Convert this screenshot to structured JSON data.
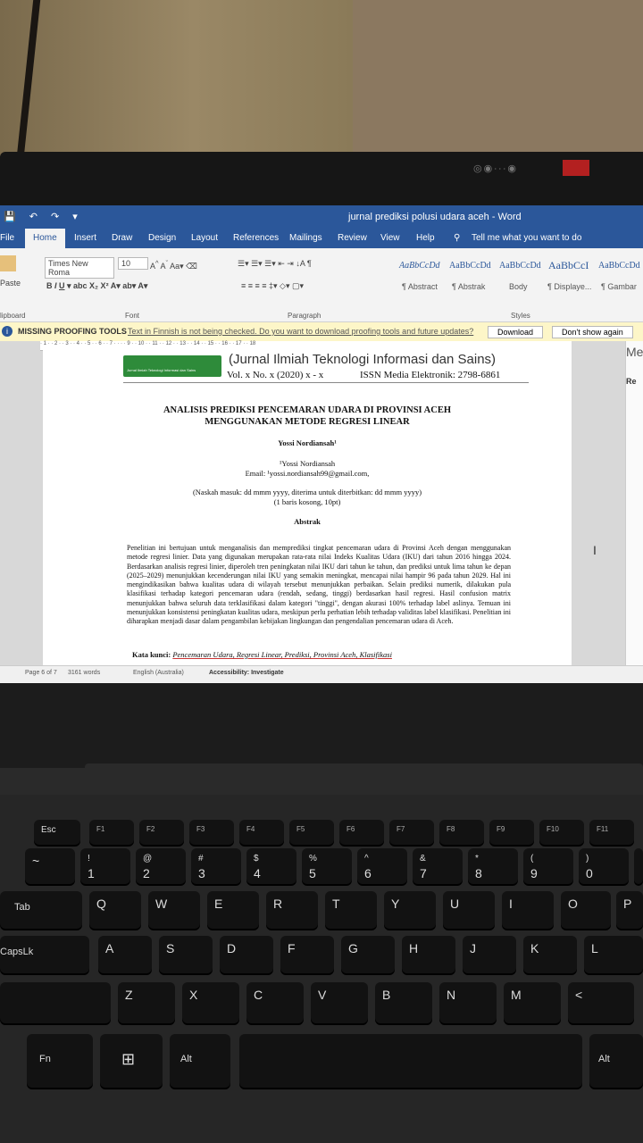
{
  "word": {
    "quick_access": "💾 ↶ ↷ ▾",
    "window_title": "jurnal prediksi polusi udara aceh  -  Word",
    "tabs": [
      "File",
      "Home",
      "Insert",
      "Draw",
      "Design",
      "Layout",
      "References",
      "Mailings",
      "Review",
      "View",
      "Help"
    ],
    "tell_me": "Tell me what you want to do",
    "font_name": "Times New Roma",
    "font_size": "10",
    "paste_label": "Paste",
    "group_clipboard": "lipboard",
    "group_font": "Font",
    "group_paragraph": "Paragraph",
    "group_styles": "Styles",
    "styles": [
      {
        "sample": "AaBbCcDd",
        "name": "¶ Abstract"
      },
      {
        "sample": "AaBbCcDd",
        "name": "¶ Abstrak"
      },
      {
        "sample": "AaBbCcDd",
        "name": "Body"
      },
      {
        "sample": "AaBbCcI",
        "name": "¶ Displaye..."
      },
      {
        "sample": "AaBbCcDd",
        "name": "¶ Gambar"
      }
    ],
    "proofing_label": "MISSING PROOFING TOOLS",
    "proofing_text": "Text in Finnish is not being checked. Do you want to download proofing tools and future updates?",
    "download_button": "Download",
    "dont_show_button": "Don't show again",
    "ruler_marks": "· 1 · · 2 · · 3 · · 4 · · 5 · · 6 · · 7 · · · · 9 · · 10 · · 11 · · 12 · · 13 · · 14 · · 15 · · 16 · · 17 · · 18",
    "side_pane": {
      "top": "Me",
      "sub": "Re"
    },
    "status": {
      "page": "Page 6 of 7",
      "words": "3161 words",
      "language": "English (Australia)",
      "accessibility": "Accessibility: Investigate"
    }
  },
  "document": {
    "journal_name": "(Jurnal Ilmiah Teknologi Informasi dan Sains)",
    "logo_tagline": "Jurnal Ilmiah Teknologi Informasi dan Sains",
    "volume": "Vol. x No. x (2020) x - x",
    "issn": "ISSN Media Elektronik: 2798-6861",
    "title_line1": "ANALISIS PREDIKSI PENCEMARAN UDARA DI PROVINSI ACEH",
    "title_line2": "MENGGUNAKAN METODE REGRESI LINEAR",
    "author": "Yossi Nordiansah¹",
    "affiliation": "¹Yossi Nordiansah",
    "email": "Email: ¹yossi.nordiansah99@gmail.com,",
    "received": "(Naskah masuk: dd mmm yyyy, diterima untuk diterbitkan: dd mmm yyyy)",
    "spacer": "(1 baris kosong, 10pt)",
    "abstract_heading": "Abstrak",
    "abstract_body": "Penelitian ini bertujuan untuk menganalisis dan memprediksi tingkat pencemaran udara di Provinsi Aceh dengan menggunakan metode regresi linier. Data yang digunakan merupakan rata-rata nilai Indeks Kualitas Udara (IKU) dari tahun 2016 hingga 2024. Berdasarkan analisis regresi linier, diperoleh tren peningkatan nilai IKU dari tahun ke tahun, dan prediksi untuk lima tahun ke depan (2025–2029) menunjukkan kecenderungan nilai IKU yang semakin meningkat, mencapai nilai hampir 96 pada tahun 2029. Hal ini mengindikasikan bahwa kualitas udara di wilayah tersebut menunjukkan perbaikan. Selain prediksi numerik, dilakukan pula klasifikasi terhadap kategori pencemaran udara (rendah, sedang, tinggi) berdasarkan hasil regresi. Hasil confusion matrix menunjukkan bahwa seluruh data terklasifikasi dalam kategori \"tinggi\", dengan akurasi 100% terhadap label aslinya. Temuan ini menunjukkan konsistensi peningkatan kualitas udara, meskipun perlu perhatian lebih terhadap validitas label klasifikasi. Penelitian ini diharapkan menjadi dasar dalam pengambilan kebijakan lingkungan dan pengendalian pencemaran udara di Aceh.",
    "keywords_label": "Kata kunci:",
    "keywords": "Pencemaran Udara, Regresi Linear, Prediksi, Provinsi Aceh, Klasifikasi"
  },
  "keyboard": {
    "fn_row": [
      "Esc",
      "F1",
      "F2",
      "F3",
      "F4",
      "F5",
      "F6",
      "F7",
      "F8",
      "F9",
      "F10",
      "F11"
    ],
    "num_row": [
      "~",
      "1",
      "2",
      "3",
      "4",
      "5",
      "6",
      "7",
      "8",
      "9",
      "0",
      "-"
    ],
    "num_row_top": [
      "",
      "!",
      "@",
      "#",
      "$",
      "%",
      "^",
      "&",
      "*",
      "(",
      ")",
      "_"
    ],
    "row_q": [
      "Tab",
      "Q",
      "W",
      "E",
      "R",
      "T",
      "Y",
      "U",
      "I",
      "O",
      "P"
    ],
    "row_a": [
      "CapsLk",
      "A",
      "S",
      "D",
      "F",
      "G",
      "H",
      "J",
      "K",
      "L"
    ],
    "row_z": [
      "",
      "Z",
      "X",
      "C",
      "V",
      "B",
      "N",
      "M",
      "<"
    ],
    "row_bottom": [
      "Fn",
      "⊞",
      "Alt",
      "",
      "Alt"
    ]
  }
}
